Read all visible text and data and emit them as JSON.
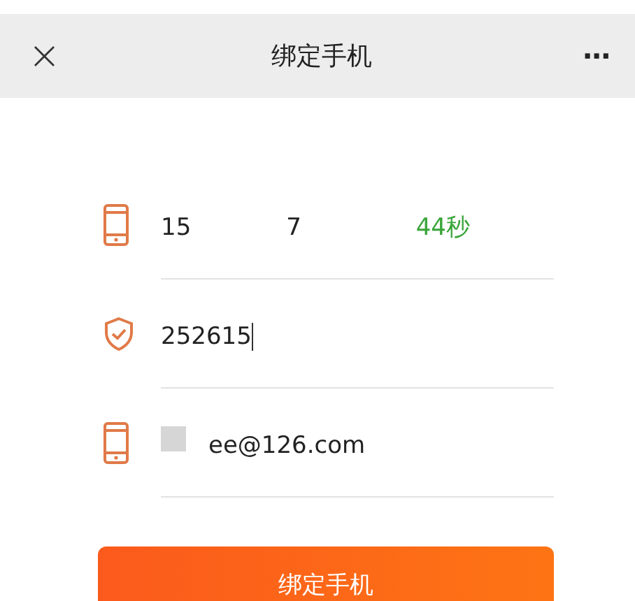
{
  "header": {
    "close": "×",
    "title": "绑定手机",
    "more": "···"
  },
  "fields": [
    {
      "kind": "phone",
      "value_start": "15",
      "value_end": "7",
      "countdown": "44秒"
    },
    {
      "kind": "code",
      "value": "252615",
      "focused": true
    },
    {
      "kind": "email",
      "value": "ee@126.com",
      "redacted_prefix": true
    }
  ],
  "submit": "绑定手机"
}
